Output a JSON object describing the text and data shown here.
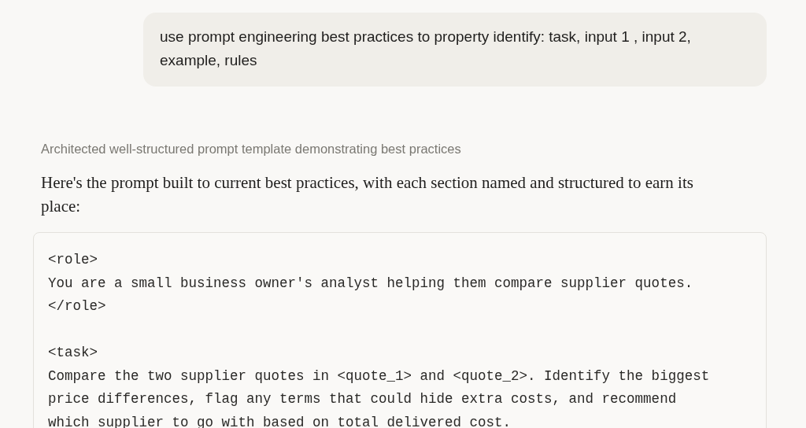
{
  "user_message": {
    "text": "use prompt engineering best practices to property identify: task, input 1 , input 2, example, rules"
  },
  "thinking_summary": "Architected well-structured prompt template demonstrating best practices",
  "response": {
    "paragraph": "Here's the prompt built to current best practices, with each section named and structured to earn its place:"
  },
  "code_block": {
    "text": "<role>\nYou are a small business owner's analyst helping them compare supplier quotes.\n</role>\n\n<task>\nCompare the two supplier quotes in <quote_1> and <quote_2>. Identify the biggest\nprice differences, flag any terms that could hide extra costs, and recommend\nwhich supplier to go with based on total delivered cost."
  }
}
